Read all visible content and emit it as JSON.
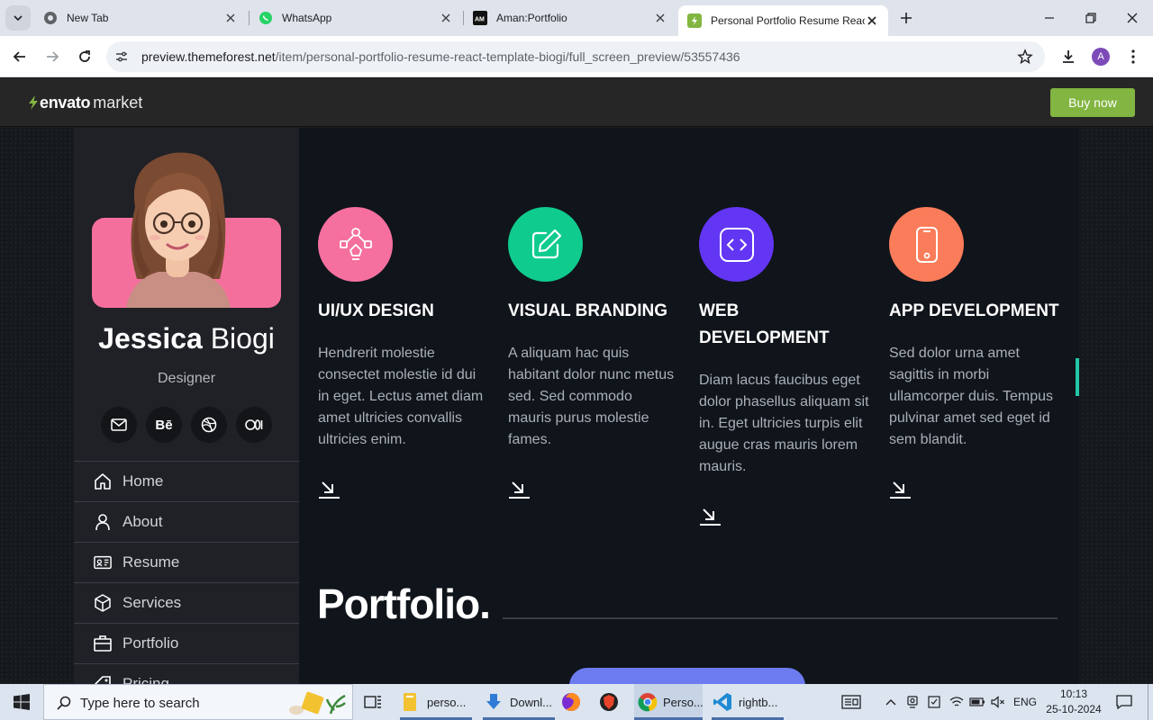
{
  "browser": {
    "tabs": [
      {
        "title": "New Tab",
        "icon": "chrome-icon"
      },
      {
        "title": "WhatsApp",
        "icon": "whatsapp-icon"
      },
      {
        "title": "Aman:Portfolio",
        "icon": "am-icon"
      },
      {
        "title": "Personal Portfolio Resume Reac",
        "icon": "envato-icon",
        "active": true
      }
    ],
    "url_domain": "preview.themeforest.net",
    "url_path": "/item/personal-portfolio-resume-react-template-biogi/full_screen_preview/53557436",
    "profile_initial": "A"
  },
  "envato": {
    "logo_bold": "envato",
    "logo_light": "market",
    "buy_label": "Buy now",
    "brand_color": "#82b541"
  },
  "profile": {
    "first_name": "Jessica",
    "last_name": "Biogi",
    "role": "Designer",
    "avatar_bg": "#f56f9c",
    "socials": [
      "mail-icon",
      "behance-icon",
      "dribbble-icon",
      "medium-icon"
    ],
    "behance_label": "Bē"
  },
  "menu": [
    {
      "label": "Home",
      "icon": "home-icon"
    },
    {
      "label": "About",
      "icon": "user-icon"
    },
    {
      "label": "Resume",
      "icon": "resume-icon"
    },
    {
      "label": "Services",
      "icon": "box-icon"
    },
    {
      "label": "Portfolio",
      "icon": "briefcase-icon"
    },
    {
      "label": "Pricing",
      "icon": "tag-icon"
    }
  ],
  "services": [
    {
      "title": "UI/UX DESIGN",
      "color": "#f5709e",
      "icon": "flow-icon",
      "text": "Hendrerit molestie consectet molestie id dui in eget. Lectus amet diam amet ultricies convallis ultricies enim."
    },
    {
      "title": "VISUAL BRANDING",
      "color": "#0fcb8e",
      "icon": "edit-icon",
      "text": "A aliquam hac quis habitant dolor nunc metus sed. Sed commodo mauris purus molestie fames."
    },
    {
      "title": "WEB DEVELOPMENT",
      "color": "#6336f4",
      "icon": "code-icon",
      "text": "Diam lacus faucibus eget dolor phasellus aliquam sit in. Eget ultricies turpis elit augue cras mauris lorem mauris."
    },
    {
      "title": "APP DEVELOPMENT",
      "color": "#fb7c5a",
      "icon": "mobile-icon",
      "text": "Sed dolor urna amet sagittis in morbi ullamcorper duis. Tempus pulvinar amet sed eget id sem blandit."
    }
  ],
  "portfolio_title": "Portfolio.",
  "taskbar": {
    "search_placeholder": "Type here to search",
    "apps": [
      {
        "label": "perso...",
        "icon": "folder-icon"
      },
      {
        "label": "Downl...",
        "icon": "download-icon"
      },
      {
        "label": "",
        "icon": "firefox-icon"
      },
      {
        "label": "",
        "icon": "brave-icon"
      },
      {
        "label": "Perso...",
        "icon": "chrome-icon"
      },
      {
        "label": "rightb...",
        "icon": "vscode-icon"
      }
    ],
    "lang": "ENG",
    "time": "10:13",
    "date": "25-10-2024"
  }
}
